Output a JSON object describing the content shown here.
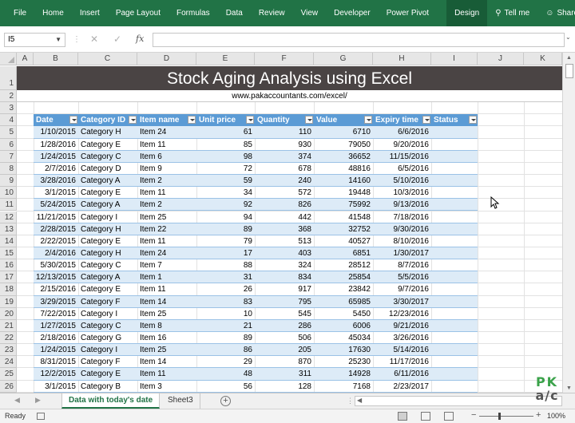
{
  "ribbon": {
    "items": [
      "File",
      "Home",
      "Insert",
      "Page Layout",
      "Formulas",
      "Data",
      "Review",
      "View",
      "Developer",
      "Power Pivot",
      "Design"
    ],
    "active": "Design",
    "tell_me": "Tell me",
    "share": "Share"
  },
  "formula_bar": {
    "name_box": "I5",
    "fx": "fx",
    "content": ""
  },
  "columns": [
    "A",
    "B",
    "C",
    "D",
    "E",
    "F",
    "G",
    "H",
    "I",
    "J",
    "K"
  ],
  "rows": [
    "1",
    "2",
    "3",
    "4",
    "5",
    "6",
    "7",
    "8",
    "9",
    "10",
    "11",
    "12",
    "13",
    "14",
    "15",
    "16",
    "17",
    "18",
    "19",
    "20",
    "21",
    "22",
    "23",
    "24",
    "25",
    "26"
  ],
  "sheet": {
    "title": "Stock Aging Analysis using Excel",
    "url": "www.pakaccountants.com/excel/"
  },
  "table": {
    "headers": [
      "Date",
      "Category ID",
      "Item name",
      "Unit price",
      "Quantity",
      "Value",
      "Expiry time",
      "Status"
    ],
    "rows": [
      [
        "1/10/2015",
        "Category H",
        "Item 24",
        "61",
        "110",
        "6710",
        "6/6/2016",
        ""
      ],
      [
        "1/28/2016",
        "Category E",
        "Item 11",
        "85",
        "930",
        "79050",
        "9/20/2016",
        ""
      ],
      [
        "1/24/2015",
        "Category C",
        "Item 6",
        "98",
        "374",
        "36652",
        "11/15/2016",
        ""
      ],
      [
        "2/7/2016",
        "Category D",
        "Item 9",
        "72",
        "678",
        "48816",
        "6/5/2016",
        ""
      ],
      [
        "3/28/2016",
        "Category A",
        "Item 2",
        "59",
        "240",
        "14160",
        "5/10/2016",
        ""
      ],
      [
        "3/1/2015",
        "Category E",
        "Item 11",
        "34",
        "572",
        "19448",
        "10/3/2016",
        ""
      ],
      [
        "5/24/2015",
        "Category A",
        "Item 2",
        "92",
        "826",
        "75992",
        "9/13/2016",
        ""
      ],
      [
        "11/21/2015",
        "Category I",
        "Item 25",
        "94",
        "442",
        "41548",
        "7/18/2016",
        ""
      ],
      [
        "2/28/2015",
        "Category H",
        "Item 22",
        "89",
        "368",
        "32752",
        "9/30/2016",
        ""
      ],
      [
        "2/22/2015",
        "Category E",
        "Item 11",
        "79",
        "513",
        "40527",
        "8/10/2016",
        ""
      ],
      [
        "2/4/2016",
        "Category H",
        "Item 24",
        "17",
        "403",
        "6851",
        "1/30/2017",
        ""
      ],
      [
        "5/30/2015",
        "Category C",
        "Item 7",
        "88",
        "324",
        "28512",
        "8/7/2016",
        ""
      ],
      [
        "12/13/2015",
        "Category A",
        "Item 1",
        "31",
        "834",
        "25854",
        "5/5/2016",
        ""
      ],
      [
        "2/15/2016",
        "Category E",
        "Item 11",
        "26",
        "917",
        "23842",
        "9/7/2016",
        ""
      ],
      [
        "3/29/2015",
        "Category F",
        "Item 14",
        "83",
        "795",
        "65985",
        "3/30/2017",
        ""
      ],
      [
        "7/22/2015",
        "Category I",
        "Item 25",
        "10",
        "545",
        "5450",
        "12/23/2016",
        ""
      ],
      [
        "1/27/2015",
        "Category C",
        "Item 8",
        "21",
        "286",
        "6006",
        "9/21/2016",
        ""
      ],
      [
        "2/18/2016",
        "Category G",
        "Item 16",
        "89",
        "506",
        "45034",
        "3/26/2016",
        ""
      ],
      [
        "1/24/2015",
        "Category I",
        "Item 25",
        "86",
        "205",
        "17630",
        "5/14/2016",
        ""
      ],
      [
        "8/31/2015",
        "Category F",
        "Item 14",
        "29",
        "870",
        "25230",
        "11/17/2016",
        ""
      ],
      [
        "12/2/2015",
        "Category E",
        "Item 11",
        "48",
        "311",
        "14928",
        "6/11/2016",
        ""
      ],
      [
        "3/1/2015",
        "Category B",
        "Item 3",
        "56",
        "128",
        "7168",
        "2/23/2017",
        ""
      ]
    ]
  },
  "tabs": {
    "active": "Data with today's date",
    "other": "Sheet3"
  },
  "status": {
    "ready": "Ready",
    "zoom": "100%"
  },
  "logo": {
    "line1": "PK",
    "line2": "a/c"
  }
}
